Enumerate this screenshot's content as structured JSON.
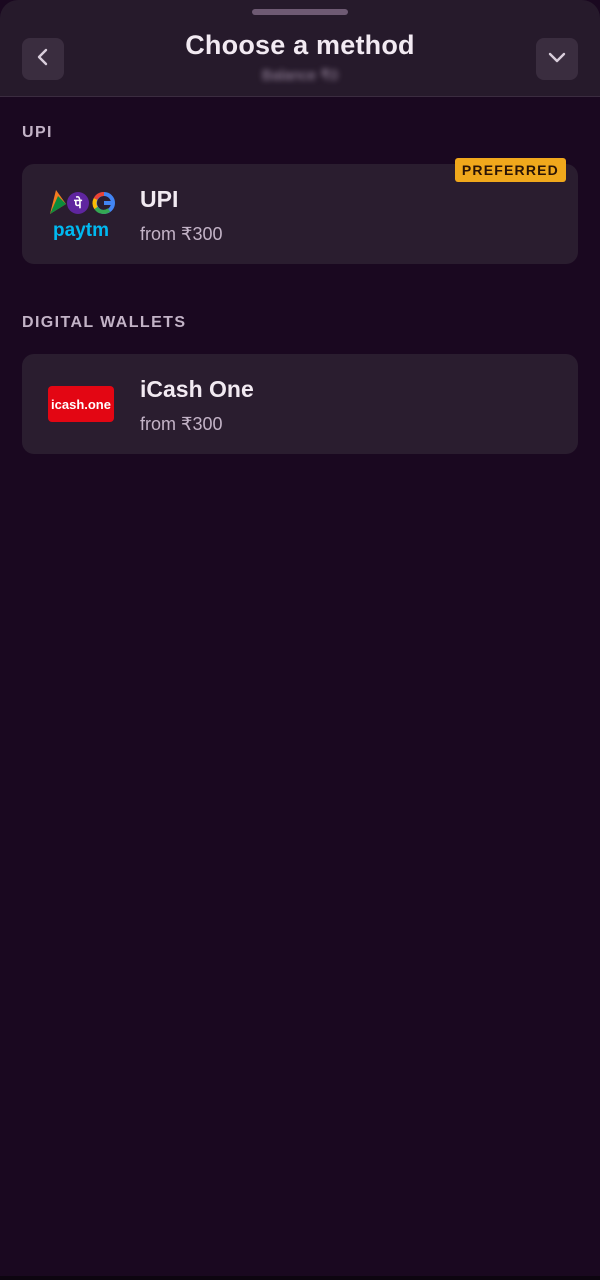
{
  "header": {
    "title": "Choose a method",
    "subtitle": "Balance ₹0",
    "back_icon": "chevron-left-icon",
    "collapse_icon": "chevron-down-icon"
  },
  "sections": [
    {
      "label": "UPI",
      "items": [
        {
          "name": "UPI",
          "subtitle": "from ₹300",
          "badge": "PREFERRED",
          "logo": "upi-apps-logo",
          "logo_text": "paytm"
        }
      ]
    },
    {
      "label": "DIGITAL WALLETS",
      "items": [
        {
          "name": "iCash One",
          "subtitle": "from ₹300",
          "logo": "icash-one-logo",
          "logo_text": "icash.one"
        }
      ]
    }
  ],
  "colors": {
    "background": "#1a0820",
    "header": "#261a2b",
    "card": "#2a1d2f",
    "badge": "#f0a81c",
    "icash_red": "#e30613"
  }
}
